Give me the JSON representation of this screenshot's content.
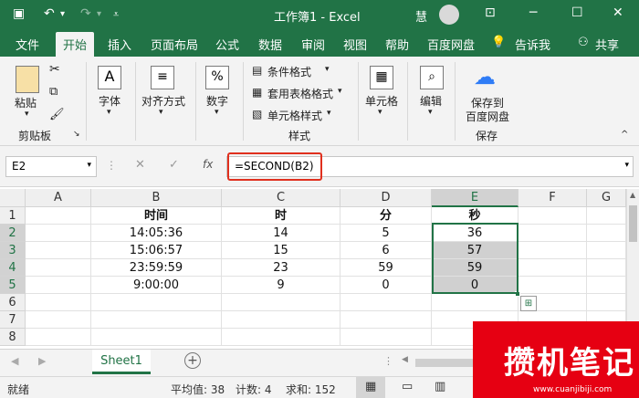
{
  "titlebar": {
    "title": "工作簿1 - Excel",
    "user": "慧",
    "icons": [
      "save-icon",
      "undo-icon",
      "redo-icon",
      "customize-icon",
      "ribbon-display-icon",
      "minimize-icon",
      "maximize-icon",
      "close-icon"
    ]
  },
  "tabs": [
    "文件",
    "开始",
    "插入",
    "页面布局",
    "公式",
    "数据",
    "审阅",
    "视图",
    "帮助",
    "百度网盘",
    "告诉我",
    "共享"
  ],
  "active_tab": "开始",
  "ribbon": {
    "paste": "粘贴",
    "clipboard_group": "剪贴板",
    "font": "字体",
    "align": "对齐方式",
    "number": "数字",
    "cond_format": "条件格式",
    "table_format": "套用表格格式",
    "cell_style": "单元格样式",
    "style_group": "样式",
    "cells": "单元格",
    "edit": "编辑",
    "save_to": "保存到",
    "baidu": "百度网盘",
    "save_group": "保存"
  },
  "formula_bar": {
    "name_box": "E2",
    "fx": "fx",
    "formula": "=SECOND(B2)"
  },
  "columns": [
    "A",
    "B",
    "C",
    "D",
    "E",
    "F",
    "G"
  ],
  "rows": [
    "1",
    "2",
    "3",
    "4",
    "5",
    "6",
    "7",
    "8"
  ],
  "table": {
    "headers": [
      "时间",
      "时",
      "分",
      "秒"
    ],
    "data": [
      [
        "14:05:36",
        "14",
        "5",
        "36"
      ],
      [
        "15:06:57",
        "15",
        "6",
        "57"
      ],
      [
        "23:59:59",
        "23",
        "59",
        "59"
      ],
      [
        "9:00:00",
        "9",
        "0",
        "0"
      ]
    ]
  },
  "sheet": {
    "tab": "Sheet1",
    "add": "+"
  },
  "status": {
    "ready": "就绪",
    "avg": "平均值: 38",
    "count": "计数: 4",
    "sum": "求和: 152"
  },
  "watermark": {
    "text": "攒机笔记",
    "url": "www.cuanjibiji.com"
  },
  "accent": "#217346",
  "highlight": "#e0301e"
}
